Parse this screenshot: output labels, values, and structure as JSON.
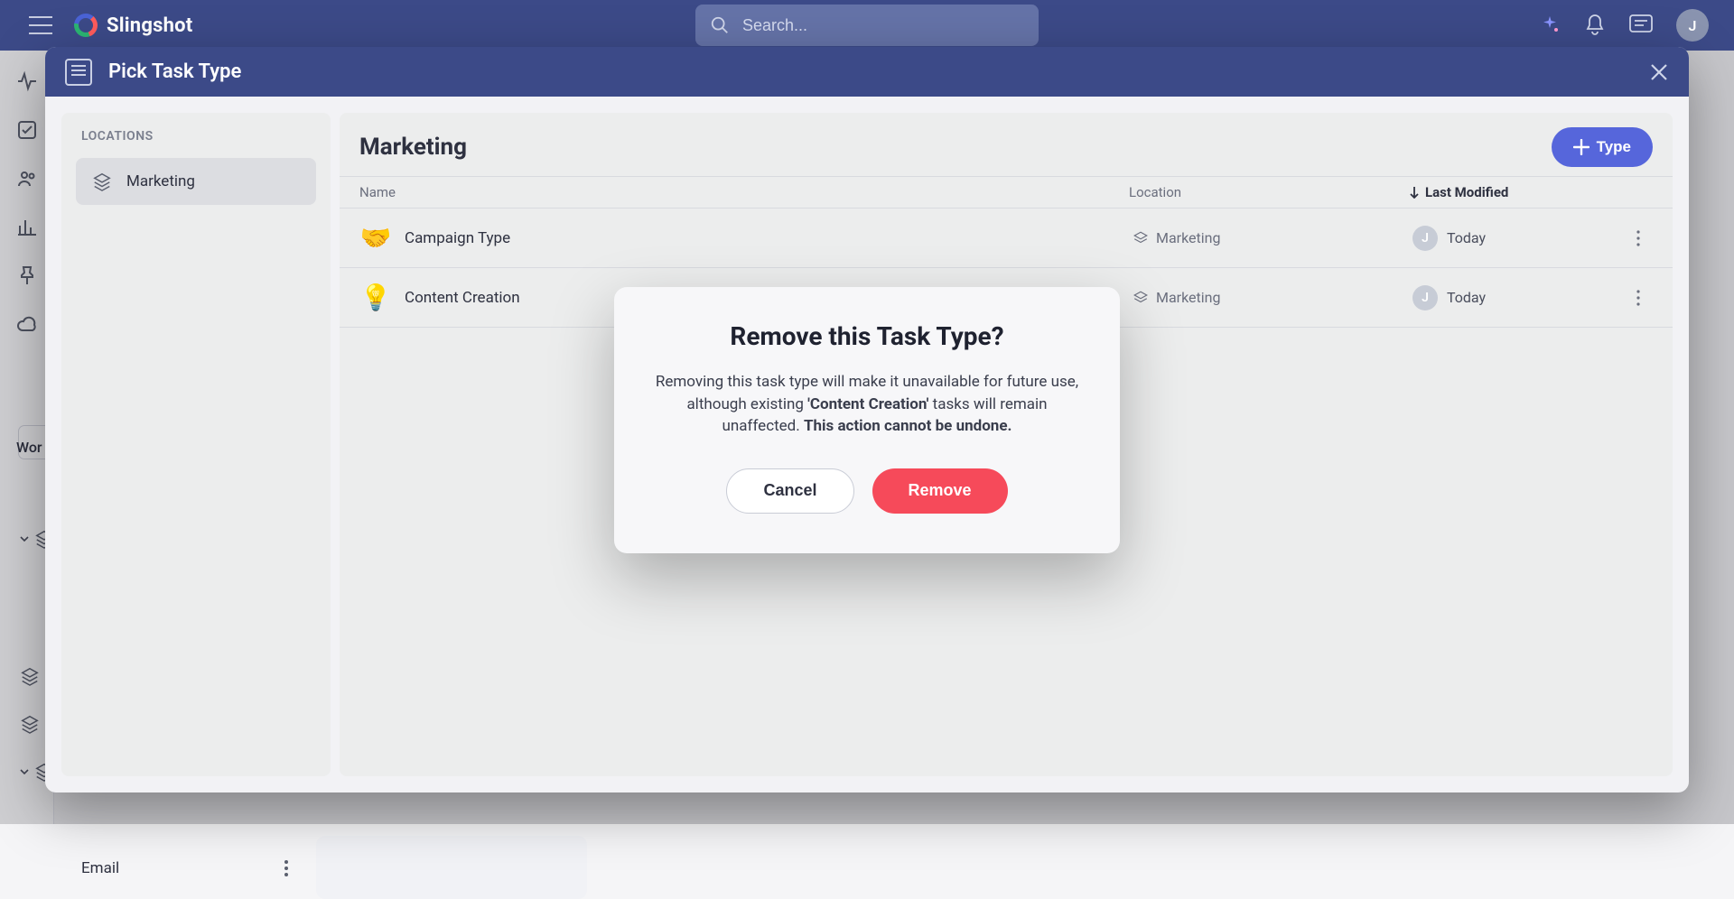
{
  "brand": {
    "name": "Slingshot"
  },
  "search": {
    "placeholder": "Search..."
  },
  "topAvatar": "J",
  "leftRail": {
    "workspaceLabel": "Wor",
    "emailLabel": "Email"
  },
  "panel": {
    "title": "Pick Task Type",
    "locationsTitle": "LOCATIONS",
    "locations": [
      {
        "label": "Marketing"
      }
    ],
    "mainTitle": "Marketing",
    "addTypeLabel": "Type",
    "columns": {
      "name": "Name",
      "location": "Location",
      "modified": "Last Modified"
    },
    "rows": [
      {
        "icon": "🤝",
        "name": "Campaign Type",
        "location": "Marketing",
        "avatar": "J",
        "modified": "Today"
      },
      {
        "icon": "💡",
        "name": "Content Creation",
        "location": "Marketing",
        "avatar": "J",
        "modified": "Today"
      }
    ]
  },
  "confirm": {
    "title": "Remove this Task Type?",
    "pre": "Removing this task type will make it unavailable for future use, although existing ",
    "strongName": "'Content Creation'",
    "mid": " tasks will remain unaffected. ",
    "bold": "This action cannot be undone.",
    "cancel": "Cancel",
    "remove": "Remove"
  }
}
